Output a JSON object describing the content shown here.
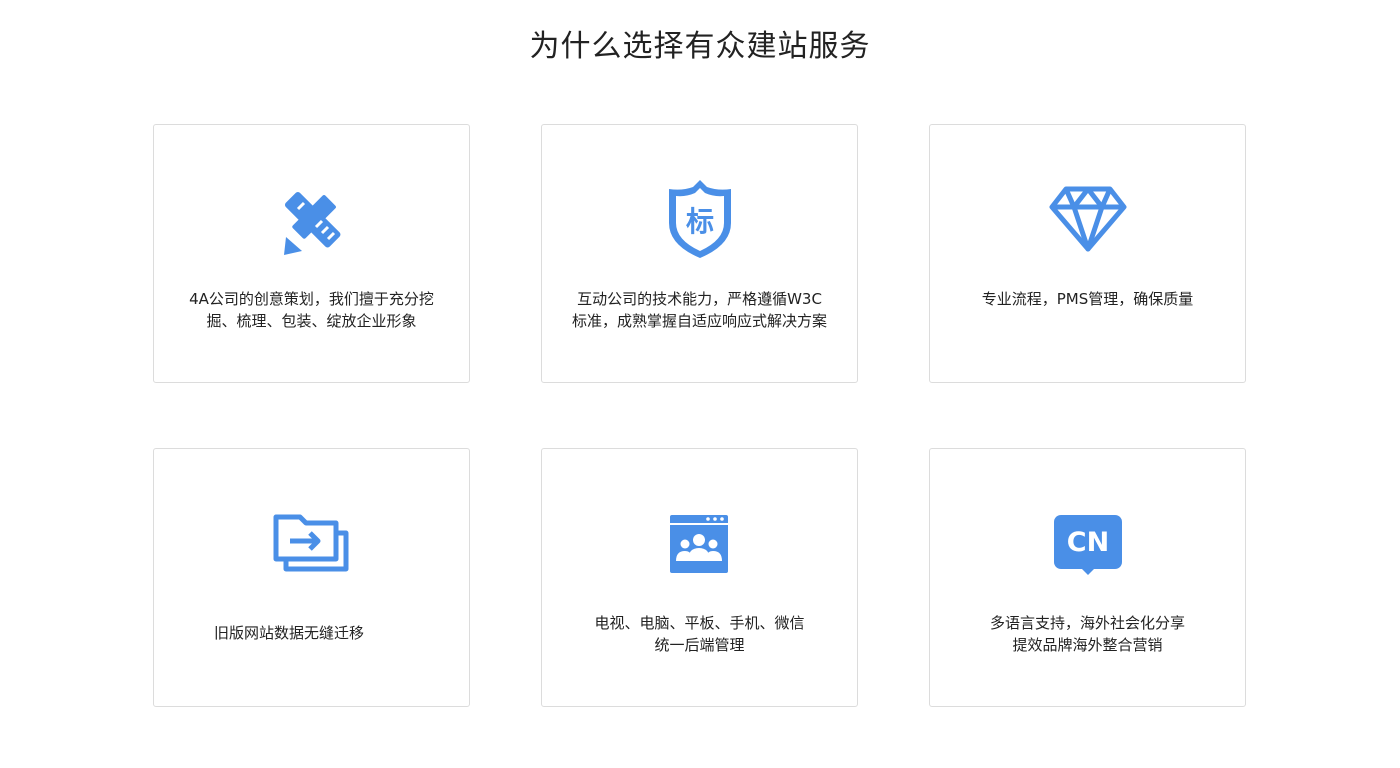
{
  "section": {
    "title": "为什么选择有众建站服务"
  },
  "colors": {
    "accent": "#4a8fe7",
    "border": "#dcdcdc",
    "text": "#222222"
  },
  "cards": [
    {
      "icon": "pencil-ruler-icon",
      "lines": [
        "4A公司的创意策划，我们擅于充分挖",
        "掘、梳理、包装、绽放企业形象"
      ]
    },
    {
      "icon": "standard-shield-icon",
      "icon_glyph": "标",
      "lines": [
        "互动公司的技术能力，严格遵循W3C",
        "标准，成熟掌握自适应响应式解决方案"
      ]
    },
    {
      "icon": "diamond-icon",
      "lines": [
        "专业流程，PMS管理，确保质量"
      ]
    },
    {
      "icon": "folder-migrate-icon",
      "lines": [
        "旧版网站数据无缝迁移"
      ]
    },
    {
      "icon": "browser-users-icon",
      "lines": [
        "电视、电脑、平板、手机、微信",
        "统一后端管理"
      ]
    },
    {
      "icon": "cn-language-icon",
      "icon_glyph": "CN",
      "lines": [
        "多语言支持，海外社会化分享",
        "提效品牌海外整合营销"
      ]
    }
  ]
}
